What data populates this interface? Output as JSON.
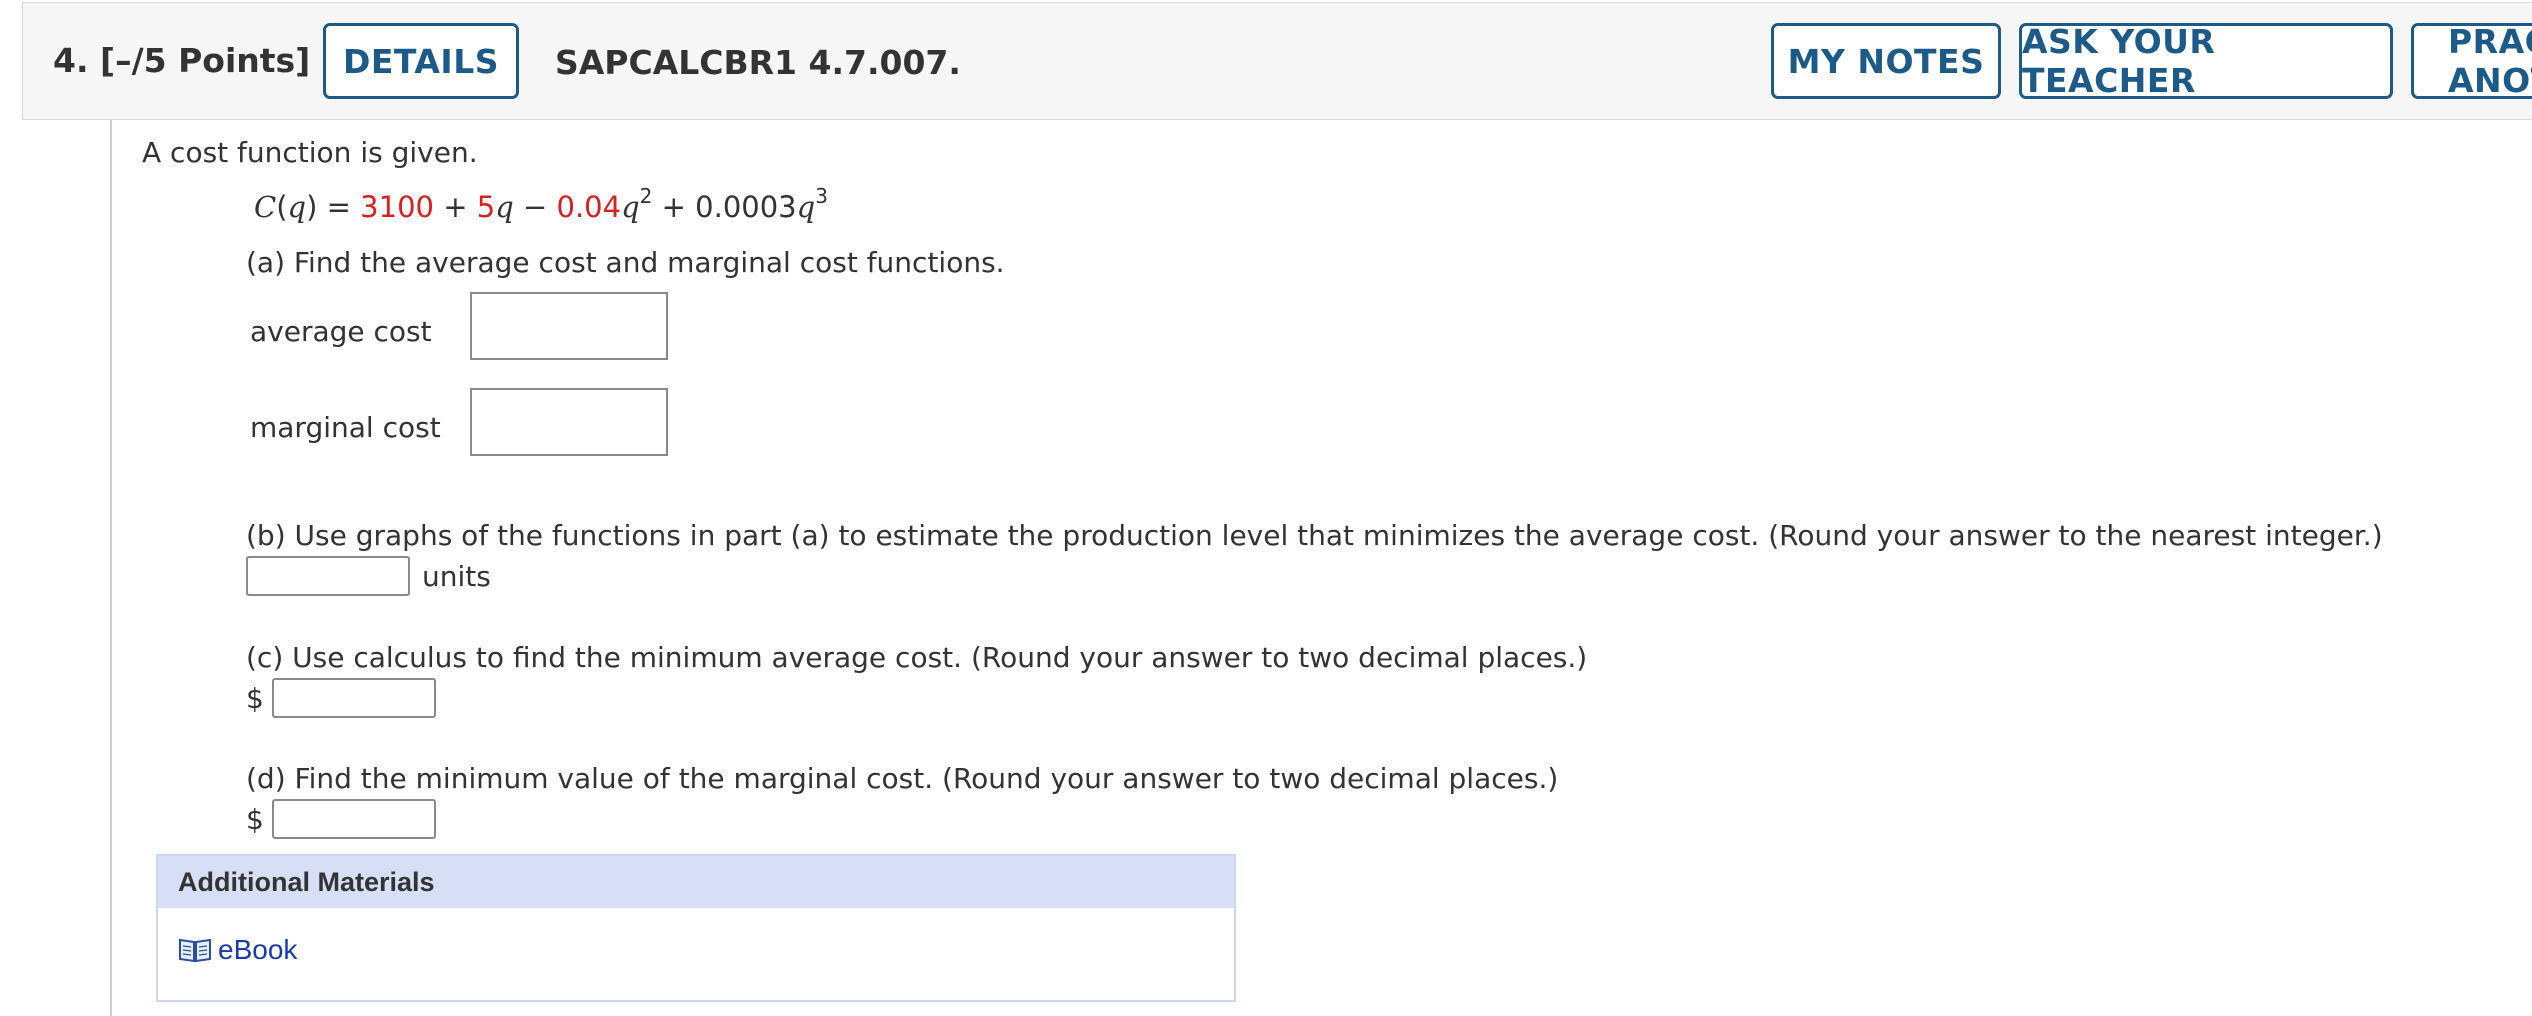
{
  "header": {
    "question_number": "4.",
    "points": "[–/5 Points]",
    "details_label": "DETAILS",
    "problem_code": "SAPCALCBR1 4.7.007.",
    "my_notes_label": "MY NOTES",
    "ask_teacher_label": "ASK YOUR TEACHER",
    "practice_label": "PRACTICE ANOTHER"
  },
  "question": {
    "intro": "A cost function is given.",
    "formula": {
      "lhs_fn": "C",
      "lhs_var": "q",
      "c0": "3100",
      "c1": "5",
      "c2": "0.04",
      "c3": "0.0003",
      "var": "q",
      "exp2": "2",
      "exp3": "3"
    },
    "part_a": "(a) Find the average cost and marginal cost functions.",
    "average_cost_label": "average cost",
    "marginal_cost_label": "marginal cost",
    "part_b": "(b) Use graphs of the functions in part (a) to estimate the production level that minimizes the average cost. (Round your answer to the nearest integer.)",
    "units_label": "units",
    "part_c": "(c) Use calculus to find the minimum average cost. (Round your answer to two decimal places.)",
    "part_d": "(d) Find the minimum value of the marginal cost. (Round your answer to two decimal places.)",
    "currency_symbol": "$"
  },
  "inputs": {
    "average_cost_value": "",
    "marginal_cost_value": "",
    "production_level_value": "",
    "min_average_cost_value": "",
    "min_marginal_cost_value": ""
  },
  "additional_materials": {
    "title": "Additional Materials",
    "ebook_label": "eBook",
    "ebook_icon": "book-icon"
  },
  "colors": {
    "accent": "#1c5a8a",
    "highlight_red": "#d8201f",
    "link": "#1a3bb0",
    "materials_header_bg": "#d6dff5"
  }
}
